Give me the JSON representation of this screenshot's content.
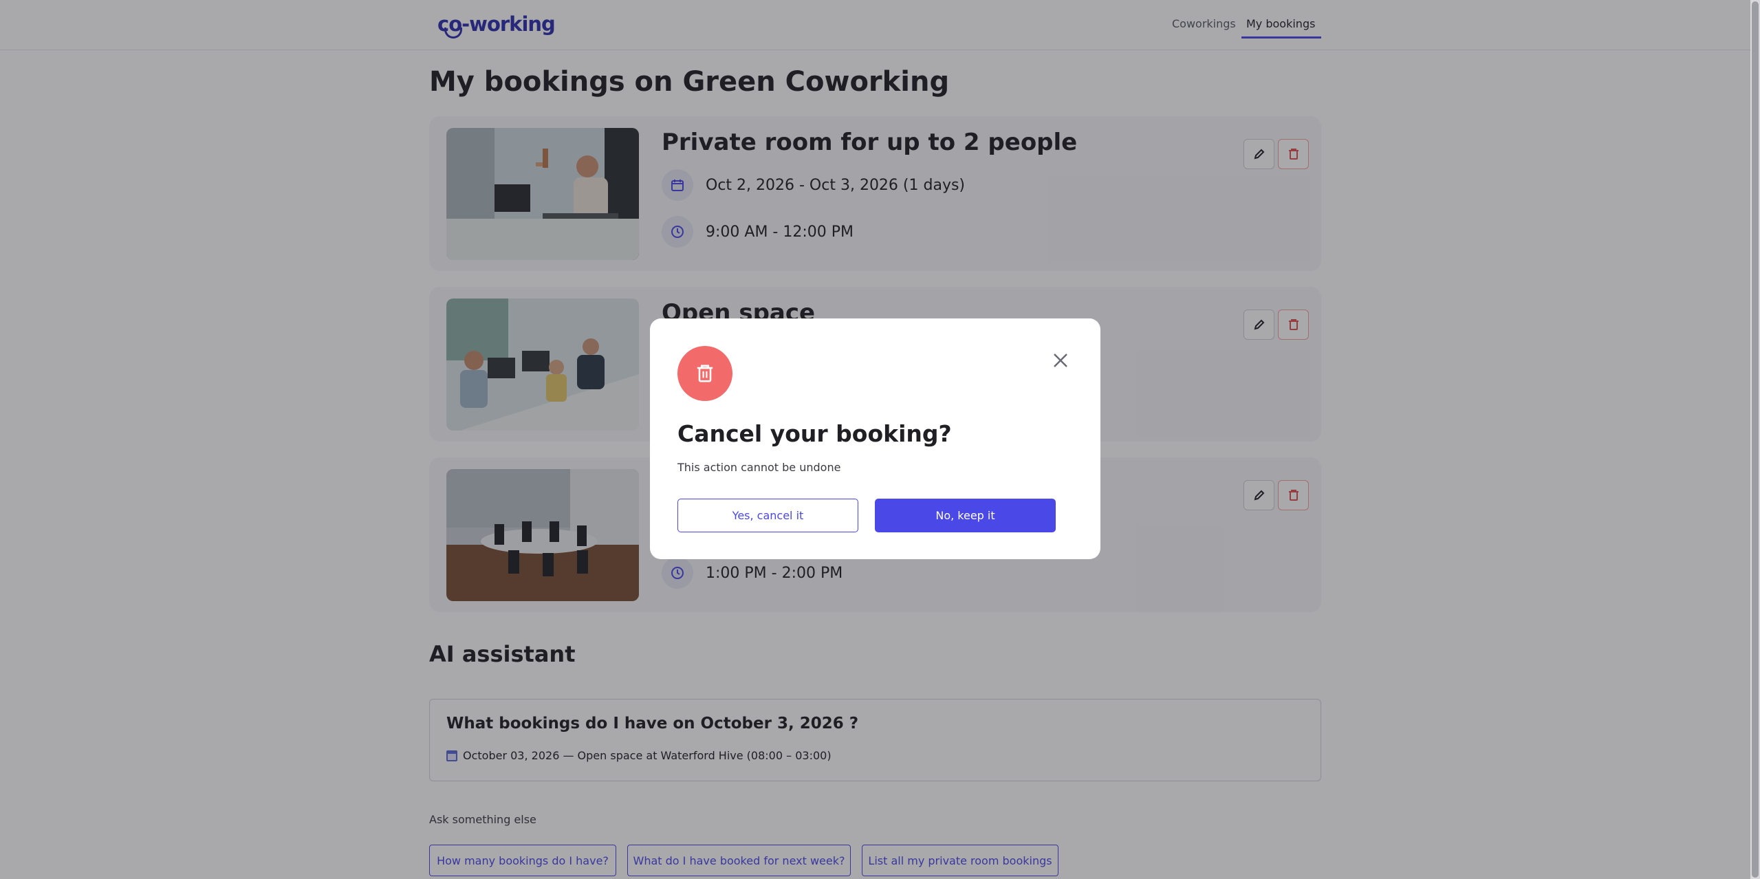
{
  "header": {
    "logo_text": "co-working",
    "nav": [
      {
        "label": "Coworkings"
      },
      {
        "label": "My bookings"
      }
    ]
  },
  "page": {
    "title": "My bookings on Green Coworking"
  },
  "bookings": [
    {
      "title": "Private room for up to 2 people",
      "dates": "Oct 2, 2026 - Oct 3, 2026 (1 days)",
      "time": "9:00 AM - 12:00 PM"
    },
    {
      "title": "Open space",
      "dates": "",
      "time": ""
    },
    {
      "title": "",
      "dates": "",
      "time": "1:00 PM - 2:00 PM"
    }
  ],
  "ai_assistant": {
    "section_title": "AI assistant",
    "question": "What bookings do I have on October 3, 2026 ?",
    "answer": "October 03, 2026 — Open space at Waterford Hive (08:00 – 03:00)",
    "ask_label": "Ask something else",
    "suggestions": [
      "How many bookings do I have?",
      "What do I have booked for next week?",
      "List all my private room bookings"
    ]
  },
  "modal": {
    "title": "Cancel your booking?",
    "subtitle": "This action cannot be undone",
    "confirm_label": "Yes, cancel it",
    "keep_label": "No, keep it"
  },
  "colors": {
    "accent": "#4b48e8",
    "danger": "#f26a6a",
    "logo": "#2f2fb0"
  }
}
